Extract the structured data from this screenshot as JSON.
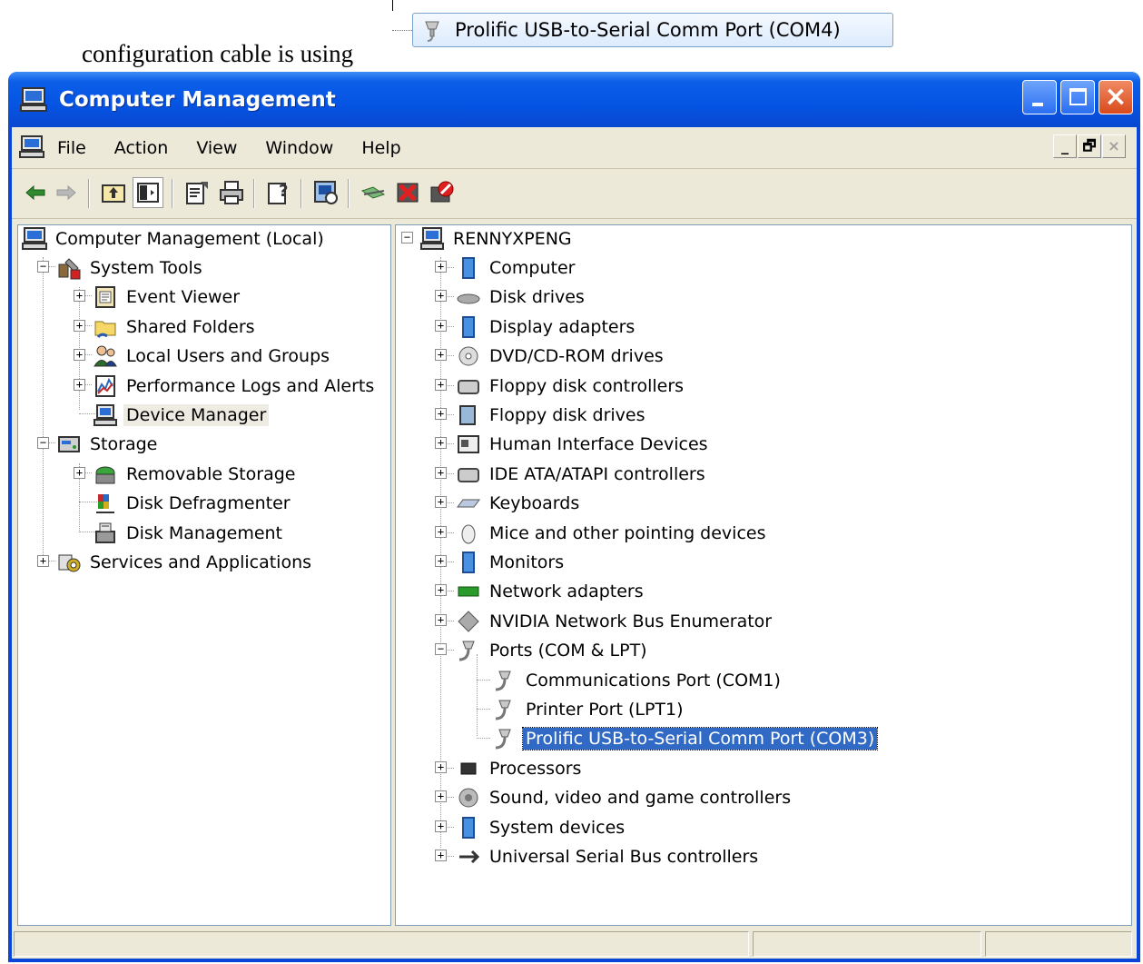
{
  "caption": {
    "text": "configuration cable is using",
    "device_label": "Prolific USB-to-Serial Comm Port (COM4)",
    "device_icon": "serial-port-icon"
  },
  "window": {
    "title": "Computer Management",
    "title_icon": "computer-management-icon",
    "title_buttons": [
      "minimize",
      "maximize",
      "close"
    ],
    "colors": {
      "titlebar": "#0554e3",
      "face": "#ece9d8",
      "selection": "#316ac5"
    }
  },
  "menu": {
    "icon": "console-icon",
    "items": [
      "File",
      "Action",
      "View",
      "Window",
      "Help"
    ],
    "mdi_buttons": [
      "_",
      "🗗",
      "×"
    ]
  },
  "toolbar": {
    "buttons": [
      "back-icon",
      "forward-icon",
      "up-one-level-icon",
      "show-hide-console-tree-icon",
      "properties-icon",
      "print-icon",
      "help-icon",
      "scan-hardware-icon",
      "update-driver-icon",
      "uninstall-icon",
      "disable-icon"
    ]
  },
  "tree": {
    "root": "Computer Management (Local)",
    "system_tools": "System Tools",
    "event_viewer": "Event Viewer",
    "shared_folders": "Shared Folders",
    "local_users": "Local Users and Groups",
    "perf_logs": "Performance Logs and Alerts",
    "device_manager": "Device Manager",
    "storage": "Storage",
    "removable_storage": "Removable Storage",
    "disk_defrag": "Disk Defragmenter",
    "disk_management": "Disk Management",
    "services_apps": "Services and Applications"
  },
  "devices": {
    "computer_name": "RENNYXPENG",
    "categories": [
      "Computer",
      "Disk drives",
      "Display adapters",
      "DVD/CD-ROM drives",
      "Floppy disk controllers",
      "Floppy disk drives",
      "Human Interface Devices",
      "IDE ATA/ATAPI controllers",
      "Keyboards",
      "Mice and other pointing devices",
      "Monitors",
      "Network adapters",
      "NVIDIA Network Bus Enumerator",
      "Ports (COM & LPT)"
    ],
    "ports": [
      "Communications Port (COM1)",
      "Printer Port (LPT1)",
      "Prolific USB-to-Serial Comm Port (COM3)"
    ],
    "selected_port": "Prolific USB-to-Serial Comm Port (COM3)",
    "after_ports": [
      "Processors",
      "Sound, video and game controllers",
      "System devices",
      "Universal Serial Bus controllers"
    ]
  },
  "statusbar": {
    "cells": [
      "",
      "",
      ""
    ]
  }
}
